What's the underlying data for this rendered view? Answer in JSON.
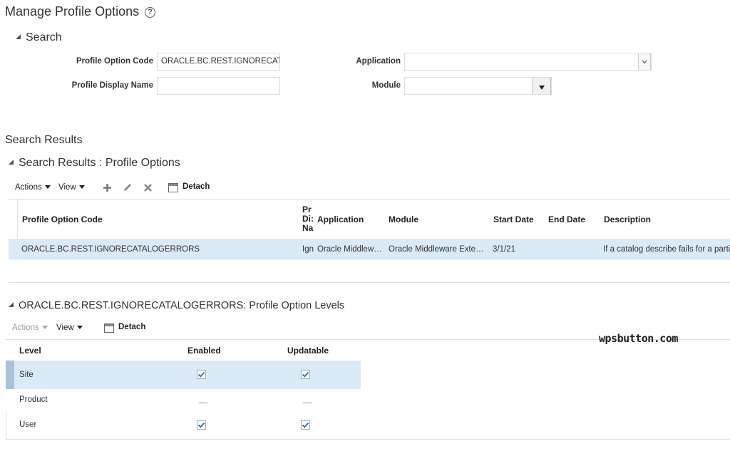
{
  "page": {
    "title": "Manage Profile Options"
  },
  "search": {
    "header": "Search",
    "profile_option_code_label": "Profile Option Code",
    "profile_option_code_value": "ORACLE.BC.REST.IGNORECAT.",
    "profile_display_name_label": "Profile Display Name",
    "profile_display_name_value": "",
    "application_label": "Application",
    "application_value": "",
    "module_label": "Module",
    "module_value": ""
  },
  "results": {
    "title": "Search Results",
    "panel_title": "Search Results : Profile Options",
    "toolbar": {
      "actions": "Actions",
      "view": "View",
      "detach": "Detach"
    },
    "columns": {
      "code": "Profile Option Code",
      "display_name_1": "Pr",
      "display_name_2": "Di:",
      "display_name_3": "Na",
      "application": "Application",
      "module": "Module",
      "start_date": "Start Date",
      "end_date": "End Date",
      "description": "Description"
    },
    "rows": [
      {
        "code": "ORACLE.BC.REST.IGNORECATALOGERRORS",
        "display_name": "Ign",
        "application": "Oracle Middlew…",
        "module": "Oracle Middleware Exte…",
        "start_date": "3/1/21",
        "end_date": "",
        "description": "If a catalog describe fails for a parti"
      }
    ]
  },
  "levels": {
    "panel_title": "ORACLE.BC.REST.IGNORECATALOGERRORS: Profile Option Levels",
    "toolbar": {
      "actions": "Actions",
      "view": "View",
      "detach": "Detach"
    },
    "columns": {
      "level": "Level",
      "enabled": "Enabled",
      "updatable": "Updatable"
    },
    "rows": [
      {
        "level": "Site",
        "enabled": true,
        "updatable": true,
        "selected": true
      },
      {
        "level": "Product",
        "enabled": null,
        "updatable": null,
        "selected": false
      },
      {
        "level": "User",
        "enabled": true,
        "updatable": true,
        "selected": false
      }
    ]
  },
  "watermark": "wpsbutton.com",
  "colors": {
    "selected_row": "#dbeaf7",
    "row_marker": "#a9c3d9",
    "accent_check": "#2a6bb0"
  }
}
